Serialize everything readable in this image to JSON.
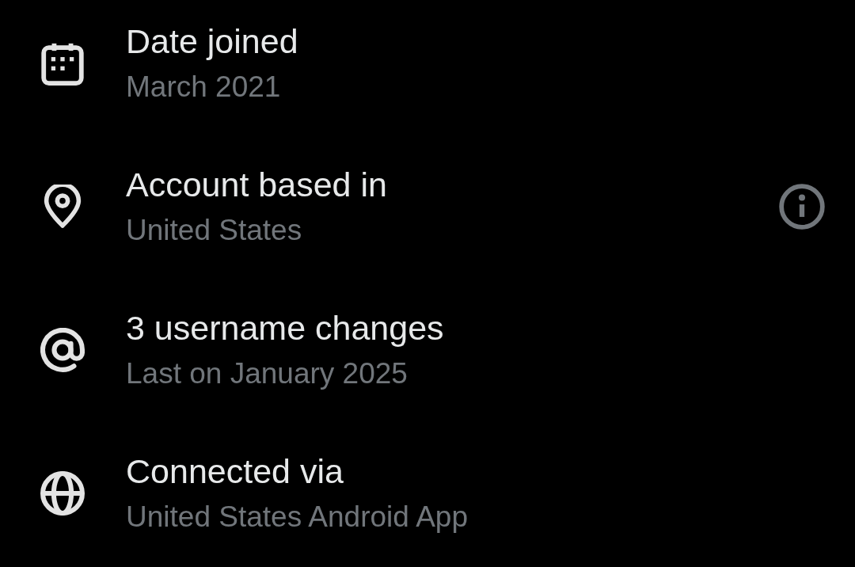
{
  "rows": [
    {
      "title": "Date joined",
      "subtitle": "March 2021",
      "info_button": false
    },
    {
      "title": "Account based in",
      "subtitle": "United States",
      "info_button": true
    },
    {
      "title": "3 username changes",
      "subtitle": "Last on January 2025",
      "info_button": false
    },
    {
      "title": "Connected via",
      "subtitle": "United States Android App",
      "info_button": false
    }
  ]
}
